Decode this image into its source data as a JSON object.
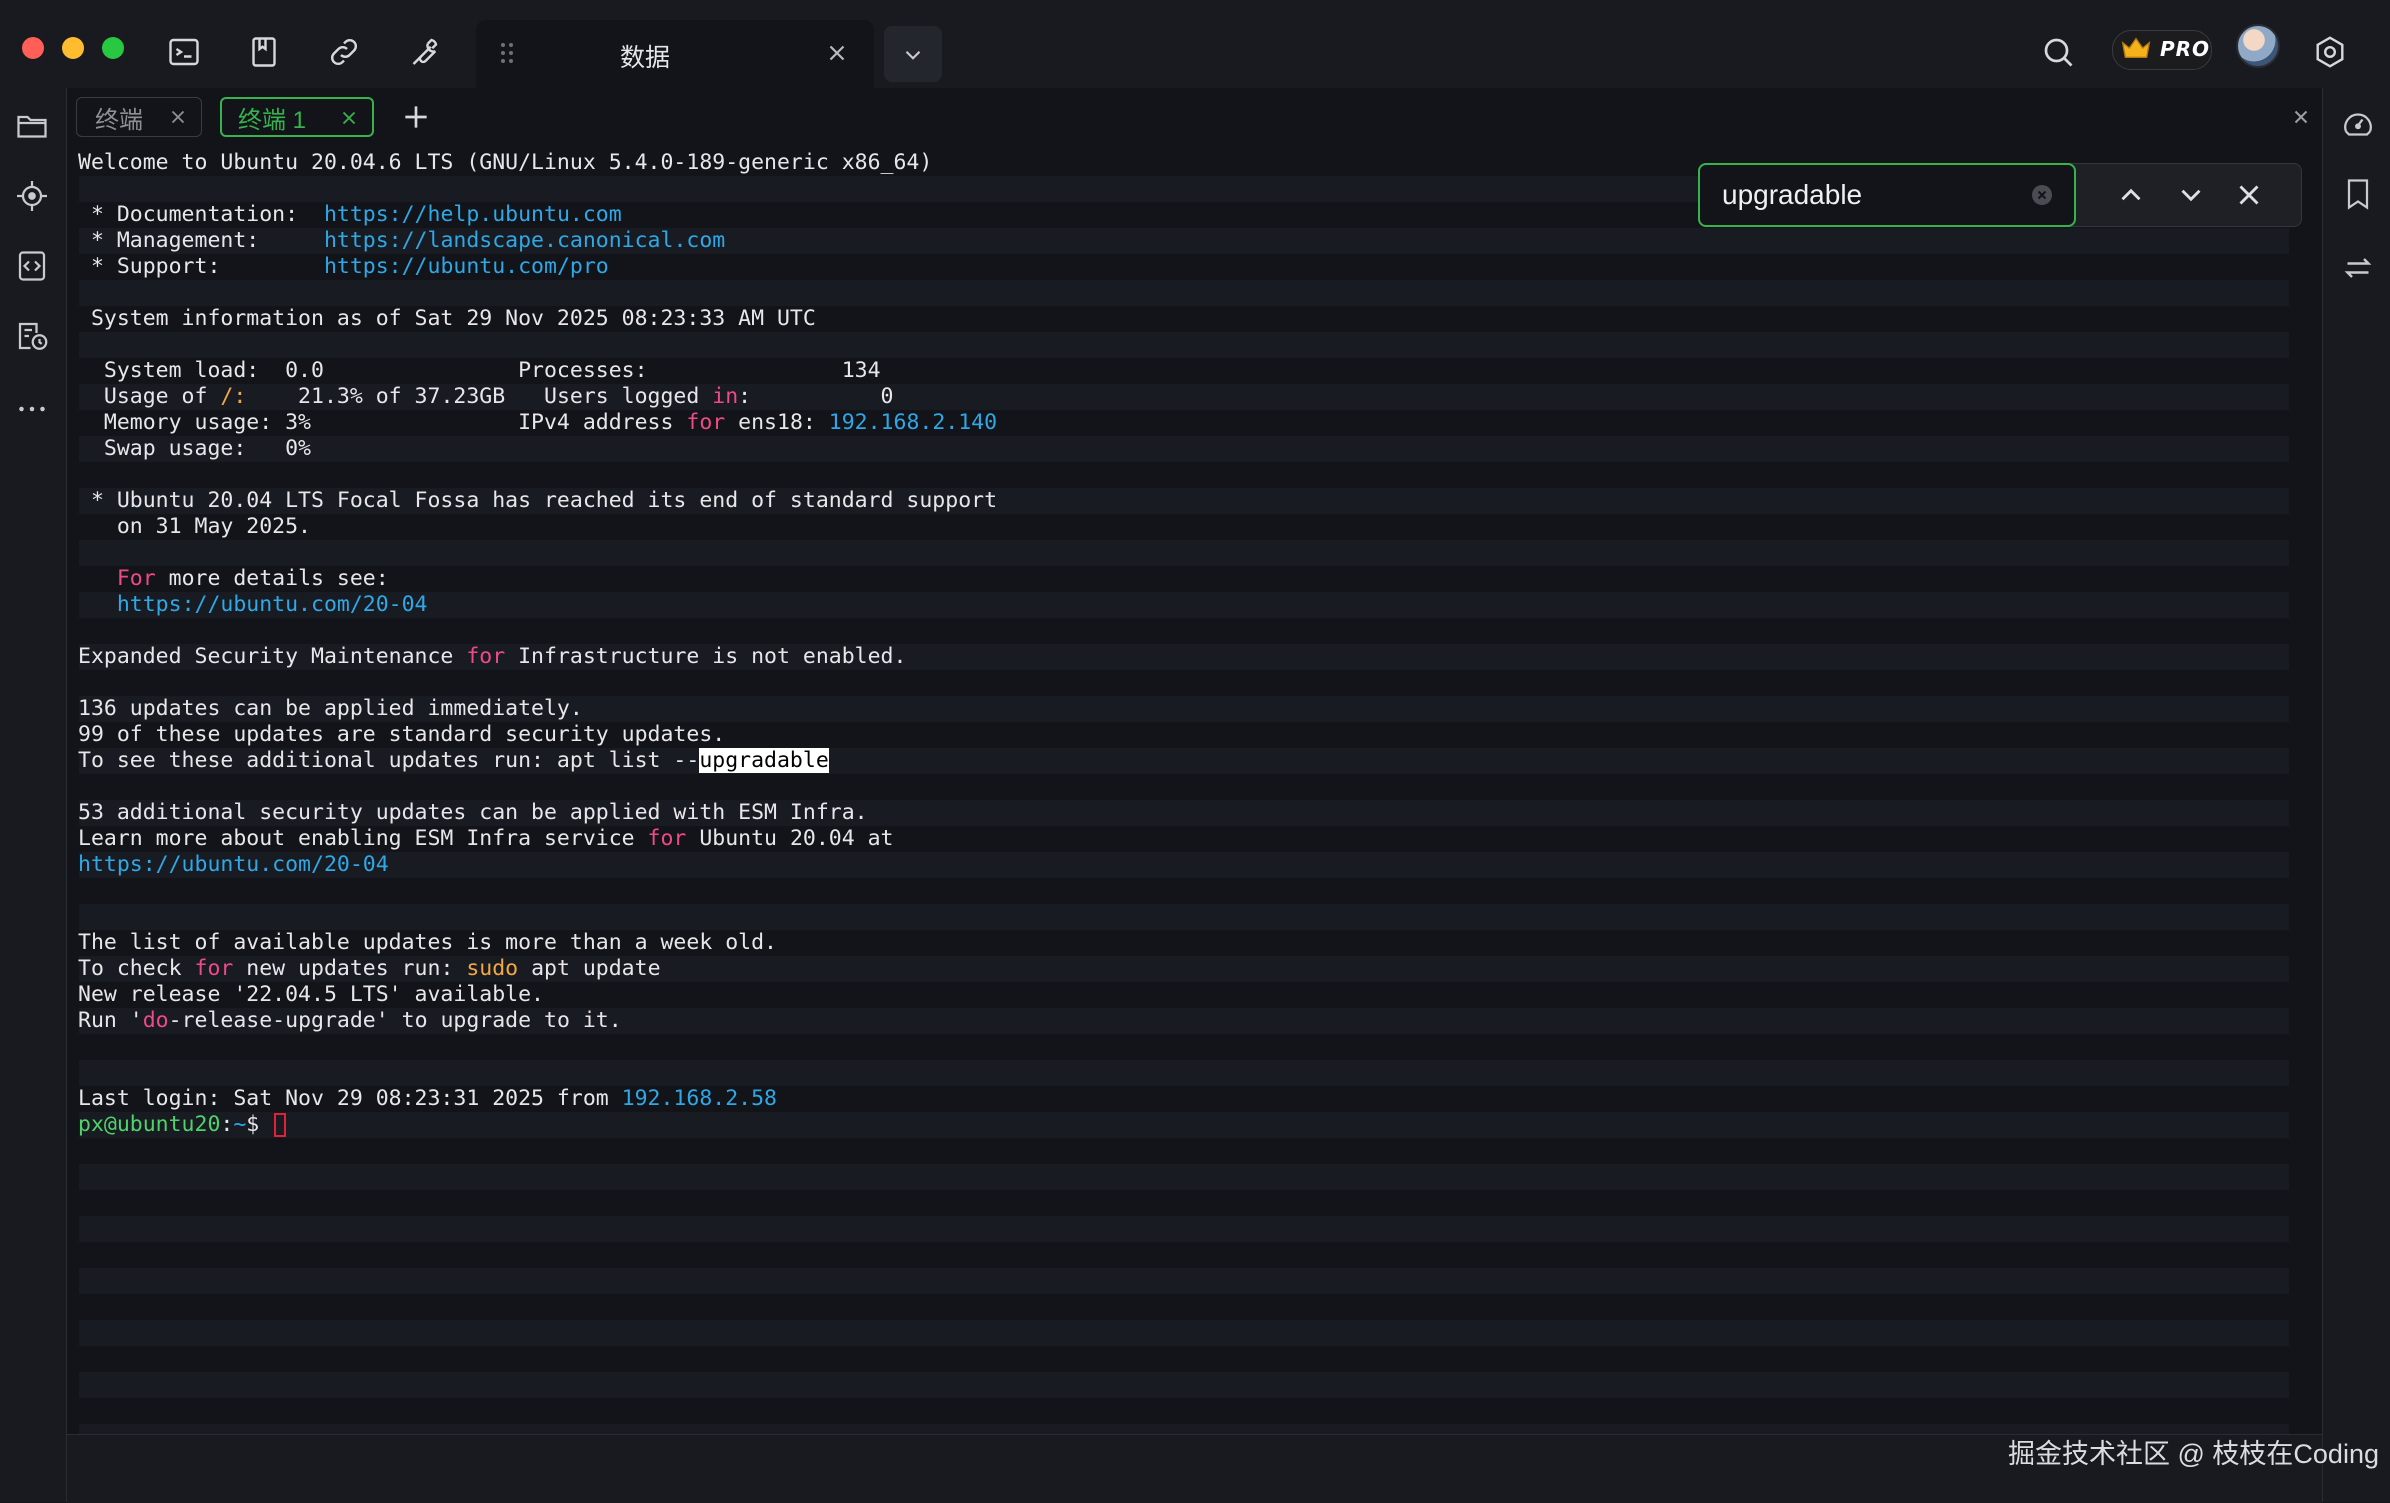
{
  "window": {
    "tab_title": "数据"
  },
  "toolbar": {
    "icons": [
      "terminal-icon",
      "bookmark-icon",
      "link-icon",
      "wrench-icon"
    ],
    "pro_label": "PRO"
  },
  "sessions": {
    "tabs": [
      {
        "label": "终端",
        "active": false
      },
      {
        "label": "终端 1",
        "active": true
      }
    ]
  },
  "search": {
    "value": "upgradable"
  },
  "terminal": {
    "lines": [
      [
        {
          "t": "Welcome to Ubuntu 20.04.6 LTS (GNU/Linux 5.4.0-189-generic x86_64)"
        }
      ],
      [],
      [
        {
          "t": " * Documentation:  "
        },
        {
          "t": "https://help.ubuntu.com",
          "c": "link"
        }
      ],
      [
        {
          "t": " * Management:     "
        },
        {
          "t": "https://landscape.canonical.com",
          "c": "link"
        }
      ],
      [
        {
          "t": " * Support:        "
        },
        {
          "t": "https://ubuntu.com/pro",
          "c": "link"
        }
      ],
      [],
      [
        {
          "t": " System information as of Sat 29 Nov 2025 08:23:33 AM UTC"
        }
      ],
      [],
      [
        {
          "t": "  System load:  0.0               Processes:               134"
        }
      ],
      [
        {
          "t": "  Usage of "
        },
        {
          "t": "/:",
          "c": "amb"
        },
        {
          "t": "    21.3% of 37.23GB   Users logged "
        },
        {
          "t": "in",
          "c": "kw"
        },
        {
          "t": ":          0"
        }
      ],
      [
        {
          "t": "  Memory usage: 3%                IPv4 address "
        },
        {
          "t": "for",
          "c": "kw"
        },
        {
          "t": " ens18: "
        },
        {
          "t": "192.168.2.140",
          "c": "link"
        }
      ],
      [
        {
          "t": "  Swap usage:   0%"
        }
      ],
      [],
      [
        {
          "t": " * Ubuntu 20.04 LTS Focal Fossa has reached its end of standard support"
        }
      ],
      [
        {
          "t": "   on 31 May 2025."
        }
      ],
      [],
      [
        {
          "t": "   "
        },
        {
          "t": "For",
          "c": "kw"
        },
        {
          "t": " more details see:"
        }
      ],
      [
        {
          "t": "   "
        },
        {
          "t": "https://ubuntu.com/20-04",
          "c": "link"
        }
      ],
      [],
      [
        {
          "t": "Expanded Security Maintenance "
        },
        {
          "t": "for",
          "c": "kw"
        },
        {
          "t": " Infrastructure is not enabled."
        }
      ],
      [],
      [
        {
          "t": "136 updates can be applied immediately."
        }
      ],
      [
        {
          "t": "99 of these updates are standard security updates."
        }
      ],
      [
        {
          "t": "To see these additional updates run: apt list --"
        },
        {
          "t": "upgradable",
          "c": "hl"
        }
      ],
      [],
      [
        {
          "t": "53 additional security updates can be applied with ESM Infra."
        }
      ],
      [
        {
          "t": "Learn more about enabling ESM Infra service "
        },
        {
          "t": "for",
          "c": "kw"
        },
        {
          "t": " Ubuntu 20.04 at"
        }
      ],
      [
        {
          "t": "https://ubuntu.com/20-04",
          "c": "link"
        }
      ],
      [],
      [],
      [
        {
          "t": "The list of available updates is more than a week old."
        }
      ],
      [
        {
          "t": "To check "
        },
        {
          "t": "for",
          "c": "kw"
        },
        {
          "t": " new updates run: "
        },
        {
          "t": "sudo",
          "c": "amb"
        },
        {
          "t": " apt update"
        }
      ],
      [
        {
          "t": "New release '22.04.5 LTS' available."
        }
      ],
      [
        {
          "t": "Run '"
        },
        {
          "t": "do",
          "c": "kw"
        },
        {
          "t": "-release-upgrade' to upgrade to it."
        }
      ],
      [],
      [],
      [
        {
          "t": "Last login: Sat Nov 29 08:23:31 2025 from "
        },
        {
          "t": "192.168.2.58",
          "c": "link"
        }
      ],
      [
        {
          "t": "px@ubuntu20",
          "c": "grn"
        },
        {
          "t": ":"
        },
        {
          "t": "~",
          "c": "link"
        },
        {
          "t": "$ "
        }
      ]
    ]
  },
  "footer": {
    "watermark": "掘金技术社区 @ 枝枝在Coding"
  },
  "colors": {
    "accent": "#37b24d",
    "link": "#2ea8e6",
    "keyword": "#ef4a85",
    "path": "#f3a93f",
    "cursor": "#e0213a"
  }
}
